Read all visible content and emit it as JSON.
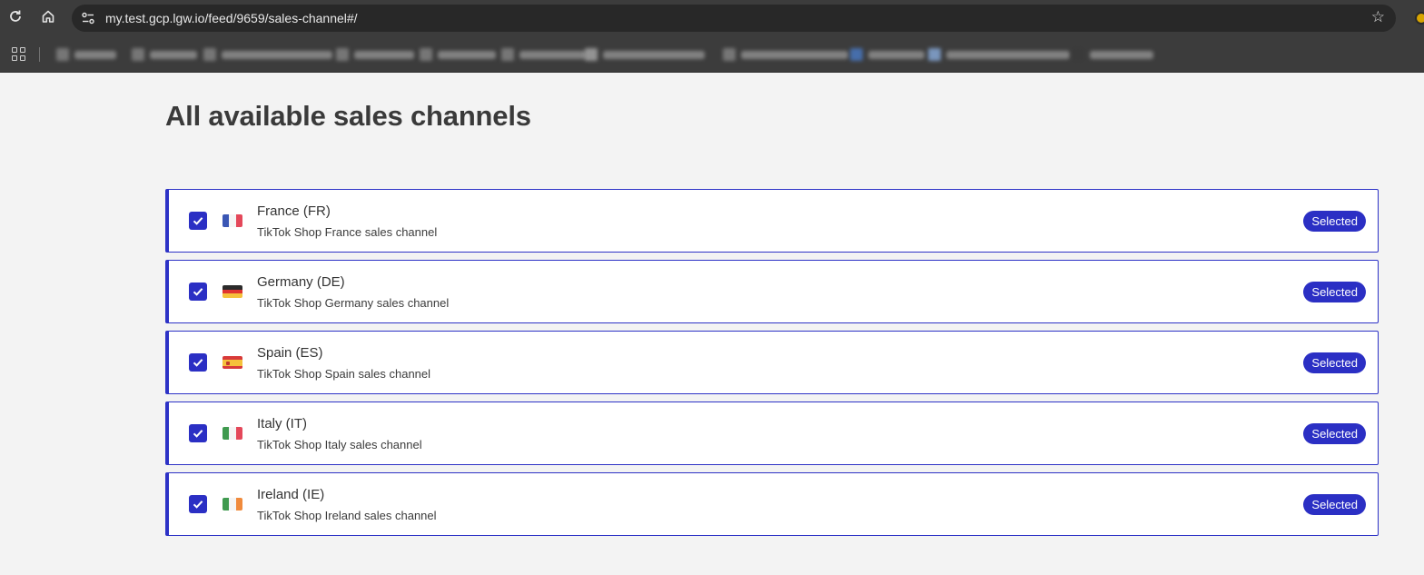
{
  "browser": {
    "url": "my.test.gcp.lgw.io/feed/9659/sales-channel#/",
    "reload_icon": "reload-icon",
    "home_icon": "home-icon",
    "bookmark_icon": "star-icon"
  },
  "page": {
    "title": "All available sales channels"
  },
  "channels": [
    {
      "name": "France (FR)",
      "description": "TikTok Shop France sales channel",
      "status": "Selected",
      "checked": true,
      "flag": "flag-fr-icon"
    },
    {
      "name": "Germany (DE)",
      "description": "TikTok Shop Germany sales channel",
      "status": "Selected",
      "checked": true,
      "flag": "flag-de-icon"
    },
    {
      "name": "Spain (ES)",
      "description": "TikTok Shop Spain sales channel",
      "status": "Selected",
      "checked": true,
      "flag": "flag-es-icon"
    },
    {
      "name": "Italy (IT)",
      "description": "TikTok Shop Italy sales channel",
      "status": "Selected",
      "checked": true,
      "flag": "flag-it-icon"
    },
    {
      "name": "Ireland (IE)",
      "description": "TikTok Shop Ireland sales channel",
      "status": "Selected",
      "checked": true,
      "flag": "flag-ie-icon"
    }
  ],
  "colors": {
    "accent": "#2b2fc4",
    "background": "#f3f3f3",
    "chrome": "#3c3c3c"
  }
}
